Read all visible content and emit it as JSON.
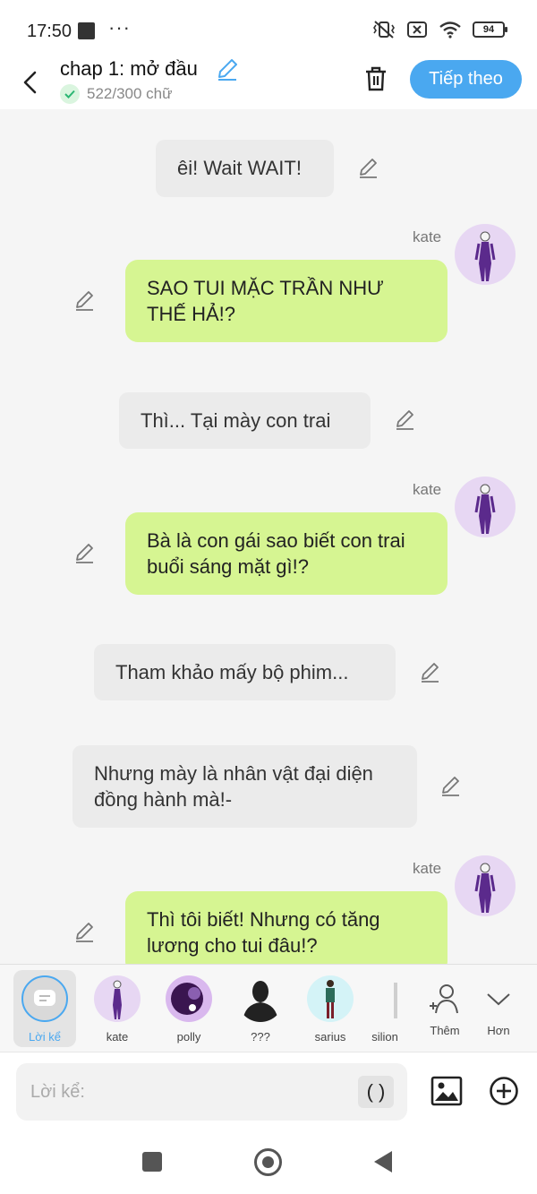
{
  "status_bar": {
    "time": "17:50",
    "more": "···",
    "battery": "94"
  },
  "header": {
    "title": "chap 1: mở đầu",
    "word_count": "522/300 chữ",
    "next_label": "Tiếp theo"
  },
  "messages": [
    {
      "type": "narration",
      "text": "êi! Wait WAIT!"
    },
    {
      "type": "character",
      "speaker": "kate",
      "text": "SAO TUI MẶC TRẦN NHƯ THẾ HẢ!?"
    },
    {
      "type": "narration",
      "text": "Thì... Tại mày con trai"
    },
    {
      "type": "character",
      "speaker": "kate",
      "text": "Bà là con gái sao biết con trai buổi sáng mặt gì!?"
    },
    {
      "type": "narration",
      "text": "Tham khảo mấy bộ phim..."
    },
    {
      "type": "narration",
      "text": "Nhưng mày là nhân vật đại diện đồng hành mà!-"
    },
    {
      "type": "character",
      "speaker": "kate",
      "text": "Thì tôi biết! Nhưng có tăng lương cho tui đâu!?"
    }
  ],
  "characters": {
    "items": [
      {
        "label": "Lời kể",
        "selected": true
      },
      {
        "label": "kate"
      },
      {
        "label": "polly"
      },
      {
        "label": "???"
      },
      {
        "label": "sarius"
      },
      {
        "label": "silion"
      }
    ],
    "add_label": "Thêm",
    "more_label": "Hơn"
  },
  "input": {
    "placeholder": "Lời kể:",
    "paren_label": "( )"
  },
  "colors": {
    "accent": "#4aa8f0",
    "character_bubble": "#d6f592",
    "narration_bubble": "#ebebeb",
    "avatar_bg": "#e7d7f3"
  }
}
